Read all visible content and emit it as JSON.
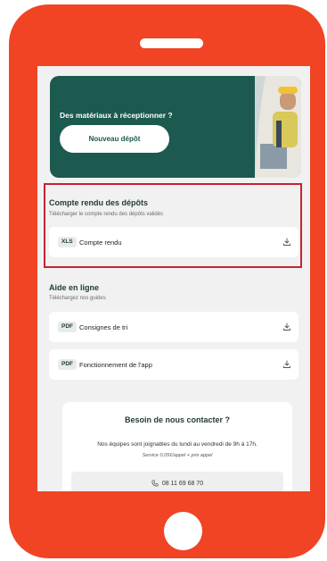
{
  "hero": {
    "title": "Des matériaux à réceptionner ?",
    "button_label": "Nouveau dépôt",
    "color": "#1c5a4f"
  },
  "reports": {
    "title": "Compte rendu des dépôts",
    "subtitle": "Télécharger le compte rendu des dépôts validés",
    "items": [
      {
        "badge": "XLS",
        "label": "Compte rendu",
        "icon": "download-icon"
      }
    ]
  },
  "help": {
    "title": "Aide en ligne",
    "subtitle": "Téléchargez nos guides",
    "items": [
      {
        "badge": "PDF",
        "label": "Consignes de tri",
        "icon": "download-icon"
      },
      {
        "badge": "PDF",
        "label": "Fonctionnement de l'app",
        "icon": "download-icon"
      }
    ]
  },
  "contact": {
    "title": "Besoin de nous contacter ?",
    "text": "Nos équipes sont joignables du lundi au vendredi de 9h à 17h.",
    "note": "Service 0,05€/appel + prix appel",
    "phone": "08 11 69 68 70",
    "phone_icon": "phone-icon"
  },
  "colors": {
    "phone_frame": "#f04424",
    "highlight": "#c5232f",
    "accent": "#1c5a4f"
  }
}
